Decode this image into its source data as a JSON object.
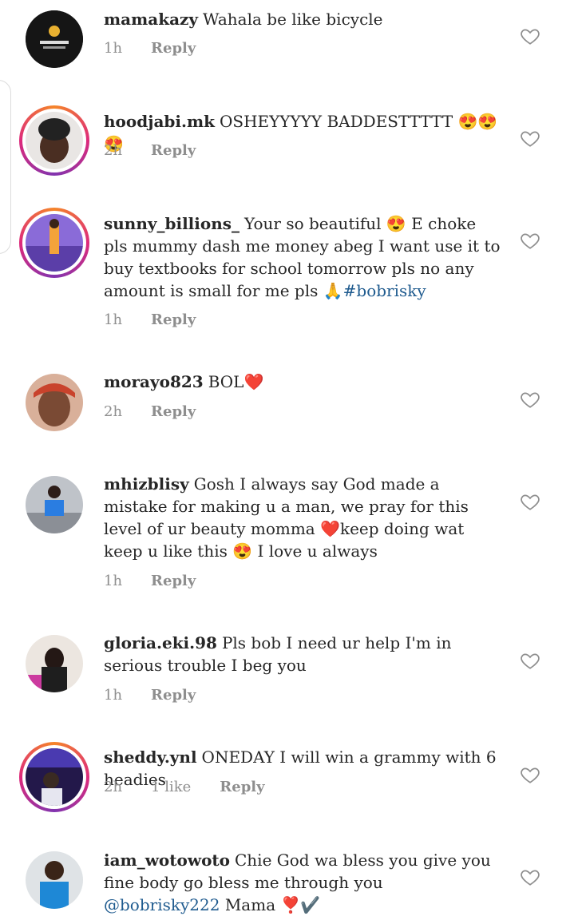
{
  "comments": [
    {
      "username": "mamakazy",
      "text": "Wahala  be like bicycle",
      "time": "1h",
      "likes": "",
      "reply": "Reply"
    },
    {
      "username": "hoodjabi.mk",
      "text": "OSHEYYYYY BADDESTTTTT 😍😍😍",
      "time": "2h",
      "likes": "",
      "reply": "Reply"
    },
    {
      "username": "sunny_billions_",
      "text": "Your so beautiful 😍 E choke pls mummy dash me money abeg I want use it to buy textbooks for school tomorrow pls no any amount is small for me pls 🙏",
      "link": "#bobrisky",
      "time": "1h",
      "likes": "",
      "reply": "Reply"
    },
    {
      "username": "morayo823",
      "text": "BOL❤️",
      "time": "2h",
      "likes": "",
      "reply": "Reply"
    },
    {
      "username": "mhizblisy",
      "text": "Gosh I always say God made a mistake for making u a man, we pray for this level of ur beauty momma ❤️keep doing wat keep u like this 😍 I love u always",
      "time": "1h",
      "likes": "",
      "reply": "Reply"
    },
    {
      "username": "gloria.eki.98",
      "text": "Pls bob I need ur help I'm in serious trouble I beg you",
      "time": "1h",
      "likes": "",
      "reply": "Reply"
    },
    {
      "username": "sheddy.ynl",
      "text": "ONEDAY I will win a grammy with 6 headies",
      "time": "2h",
      "likes": "1 like",
      "reply": "Reply"
    },
    {
      "username": "iam_wotowoto",
      "text": "Chie God wa bless you give you fine body go bless me through you",
      "link": "@bobrisky222",
      "text_after": "  Mama ❣️✔️",
      "time": "",
      "likes": "",
      "reply": ""
    }
  ],
  "colors": {
    "text": "#262626",
    "meta": "#8e8e8e",
    "link": "#1f5b8f",
    "ring_start": "#f58529",
    "ring_end": "#8134af"
  },
  "icons": {
    "like": "heart-outline-icon"
  }
}
